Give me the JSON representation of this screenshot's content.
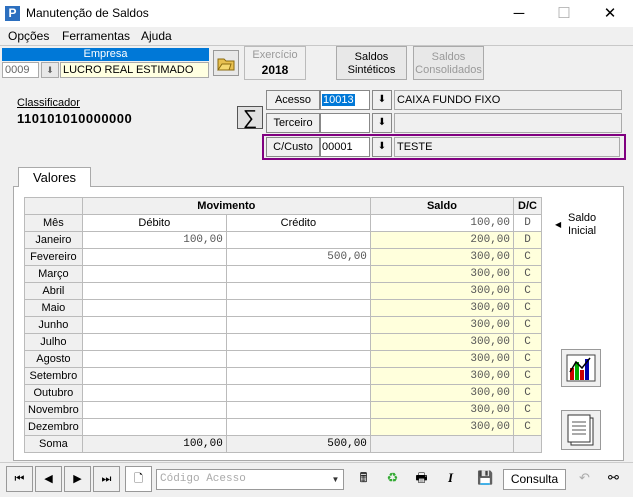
{
  "window": {
    "title": "Manutenção de Saldos",
    "app_icon": "P",
    "minimize": "─",
    "maximize": "☐",
    "close": "✕"
  },
  "menu": [
    "Opções",
    "Ferramentas",
    "Ajuda"
  ],
  "empresa": {
    "label": "Empresa",
    "code": "0009",
    "name": "LUCRO REAL ESTIMADO"
  },
  "exercicio": {
    "label": "Exercício",
    "value": "2018"
  },
  "buttons": {
    "saldos_sinteticos_1": "Saldos",
    "saldos_sinteticos_2": "Sintéticos",
    "saldos_consolidados_1": "Saldos",
    "saldos_consolidados_2": "Consolidados"
  },
  "classificador": {
    "label": "Classificador",
    "value": "110101010000000"
  },
  "fields": {
    "acesso": {
      "label": "Acesso",
      "value": "10013",
      "desc": "CAIXA FUNDO FIXO"
    },
    "terceiro": {
      "label": "Terceiro",
      "value": "",
      "desc": ""
    },
    "ccusto": {
      "label": "C/Custo",
      "value": "00001",
      "desc": "TESTE"
    }
  },
  "tab": "Valores",
  "grid": {
    "headers": {
      "movimento": "Movimento",
      "saldo": "Saldo",
      "dc": "D/C",
      "mes": "Mês",
      "debito": "Débito",
      "credito": "Crédito"
    },
    "initial": {
      "saldo": "100,00",
      "dc": "D"
    },
    "rows": [
      {
        "mes": "Janeiro",
        "debito": "100,00",
        "credito": "",
        "saldo": "200,00",
        "dc": "D"
      },
      {
        "mes": "Fevereiro",
        "debito": "",
        "credito": "500,00",
        "saldo": "300,00",
        "dc": "C"
      },
      {
        "mes": "Março",
        "debito": "",
        "credito": "",
        "saldo": "300,00",
        "dc": "C"
      },
      {
        "mes": "Abril",
        "debito": "",
        "credito": "",
        "saldo": "300,00",
        "dc": "C"
      },
      {
        "mes": "Maio",
        "debito": "",
        "credito": "",
        "saldo": "300,00",
        "dc": "C"
      },
      {
        "mes": "Junho",
        "debito": "",
        "credito": "",
        "saldo": "300,00",
        "dc": "C"
      },
      {
        "mes": "Julho",
        "debito": "",
        "credito": "",
        "saldo": "300,00",
        "dc": "C"
      },
      {
        "mes": "Agosto",
        "debito": "",
        "credito": "",
        "saldo": "300,00",
        "dc": "C"
      },
      {
        "mes": "Setembro",
        "debito": "",
        "credito": "",
        "saldo": "300,00",
        "dc": "C"
      },
      {
        "mes": "Outubro",
        "debito": "",
        "credito": "",
        "saldo": "300,00",
        "dc": "C"
      },
      {
        "mes": "Novembro",
        "debito": "",
        "credito": "",
        "saldo": "300,00",
        "dc": "C"
      },
      {
        "mes": "Dezembro",
        "debito": "",
        "credito": "",
        "saldo": "300,00",
        "dc": "C"
      }
    ],
    "total": {
      "label": "Soma",
      "debito": "100,00",
      "credito": "500,00"
    }
  },
  "saldo_inicial": {
    "line1": "Saldo",
    "line2": "Inicial"
  },
  "bottom": {
    "codigo_placeholder": "Código Acesso",
    "mode": "Consulta"
  },
  "icons": {
    "first": "first-record-icon",
    "prev": "prev-record-icon",
    "next": "next-record-icon",
    "last": "last-record-icon"
  }
}
